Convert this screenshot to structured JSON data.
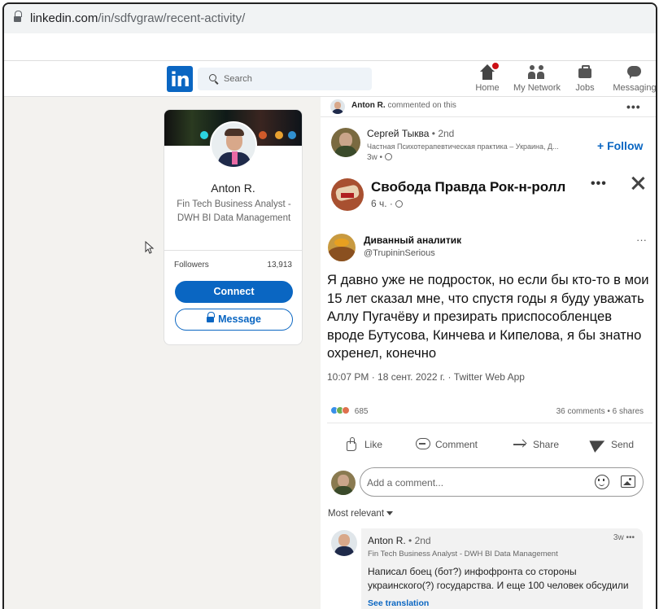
{
  "browser": {
    "url_host": "linkedin.com",
    "url_path": "/in/sdfvgraw/recent-activity/"
  },
  "nav": {
    "logo": "in",
    "search_placeholder": "Search",
    "items": [
      {
        "label": "Home",
        "icon": "home-icon"
      },
      {
        "label": "My Network",
        "icon": "network-icon"
      },
      {
        "label": "Jobs",
        "icon": "briefcase-icon"
      },
      {
        "label": "Messaging",
        "icon": "messaging-icon"
      }
    ]
  },
  "profile": {
    "name": "Anton R.",
    "headline": "Fin Tech Business Analyst - DWH BI Data Management",
    "followers_label": "Followers",
    "followers_value": "13,913",
    "connect_label": "Connect",
    "message_label": "Message"
  },
  "post": {
    "context_name": "Anton R.",
    "context_action": "commented on this",
    "author_name": "Сергей Тыква",
    "author_degree": "• 2nd",
    "author_sub": "Частная Психотерапевтическая практика – Украина, Д...",
    "author_time": "3w •",
    "follow_label": "+ Follow",
    "shared": {
      "title": "Свобода Правда Рок-н-ролл",
      "time": "6 ч. ·"
    },
    "tweet": {
      "name": "Диванный аналитик",
      "handle": "@TrupininSerious",
      "text": "Я давно уже не подросток, но если бы кто-то в мои 15 лет сказал мне, что спустя годы я буду уважать Аллу Пугачёву и презирать приспособленцев вроде Бутусова, Кинчева и Кипелова, я бы знатно охренел, конечно",
      "meta": "10:07 PM · 18 сент. 2022 г. · Twitter Web App"
    },
    "reactions_count": "685",
    "counts": "36 comments • 6 shares",
    "actions": {
      "like": "Like",
      "comment": "Comment",
      "share": "Share",
      "send": "Send"
    },
    "comment_placeholder": "Add a comment...",
    "sort_label": "Most relevant",
    "comment": {
      "name": "Anton R.",
      "degree": "• 2nd",
      "time": "3w •••",
      "headline": "Fin Tech Business Analyst - DWH BI Data Management",
      "text": "Написал боец (бот?) инфофронта со стороны украинского(?) государства. И еще 100 человек обсудили",
      "see_translation": "See translation"
    }
  },
  "colors": {
    "brand": "#0a66c2",
    "notification": "#cc1016"
  }
}
